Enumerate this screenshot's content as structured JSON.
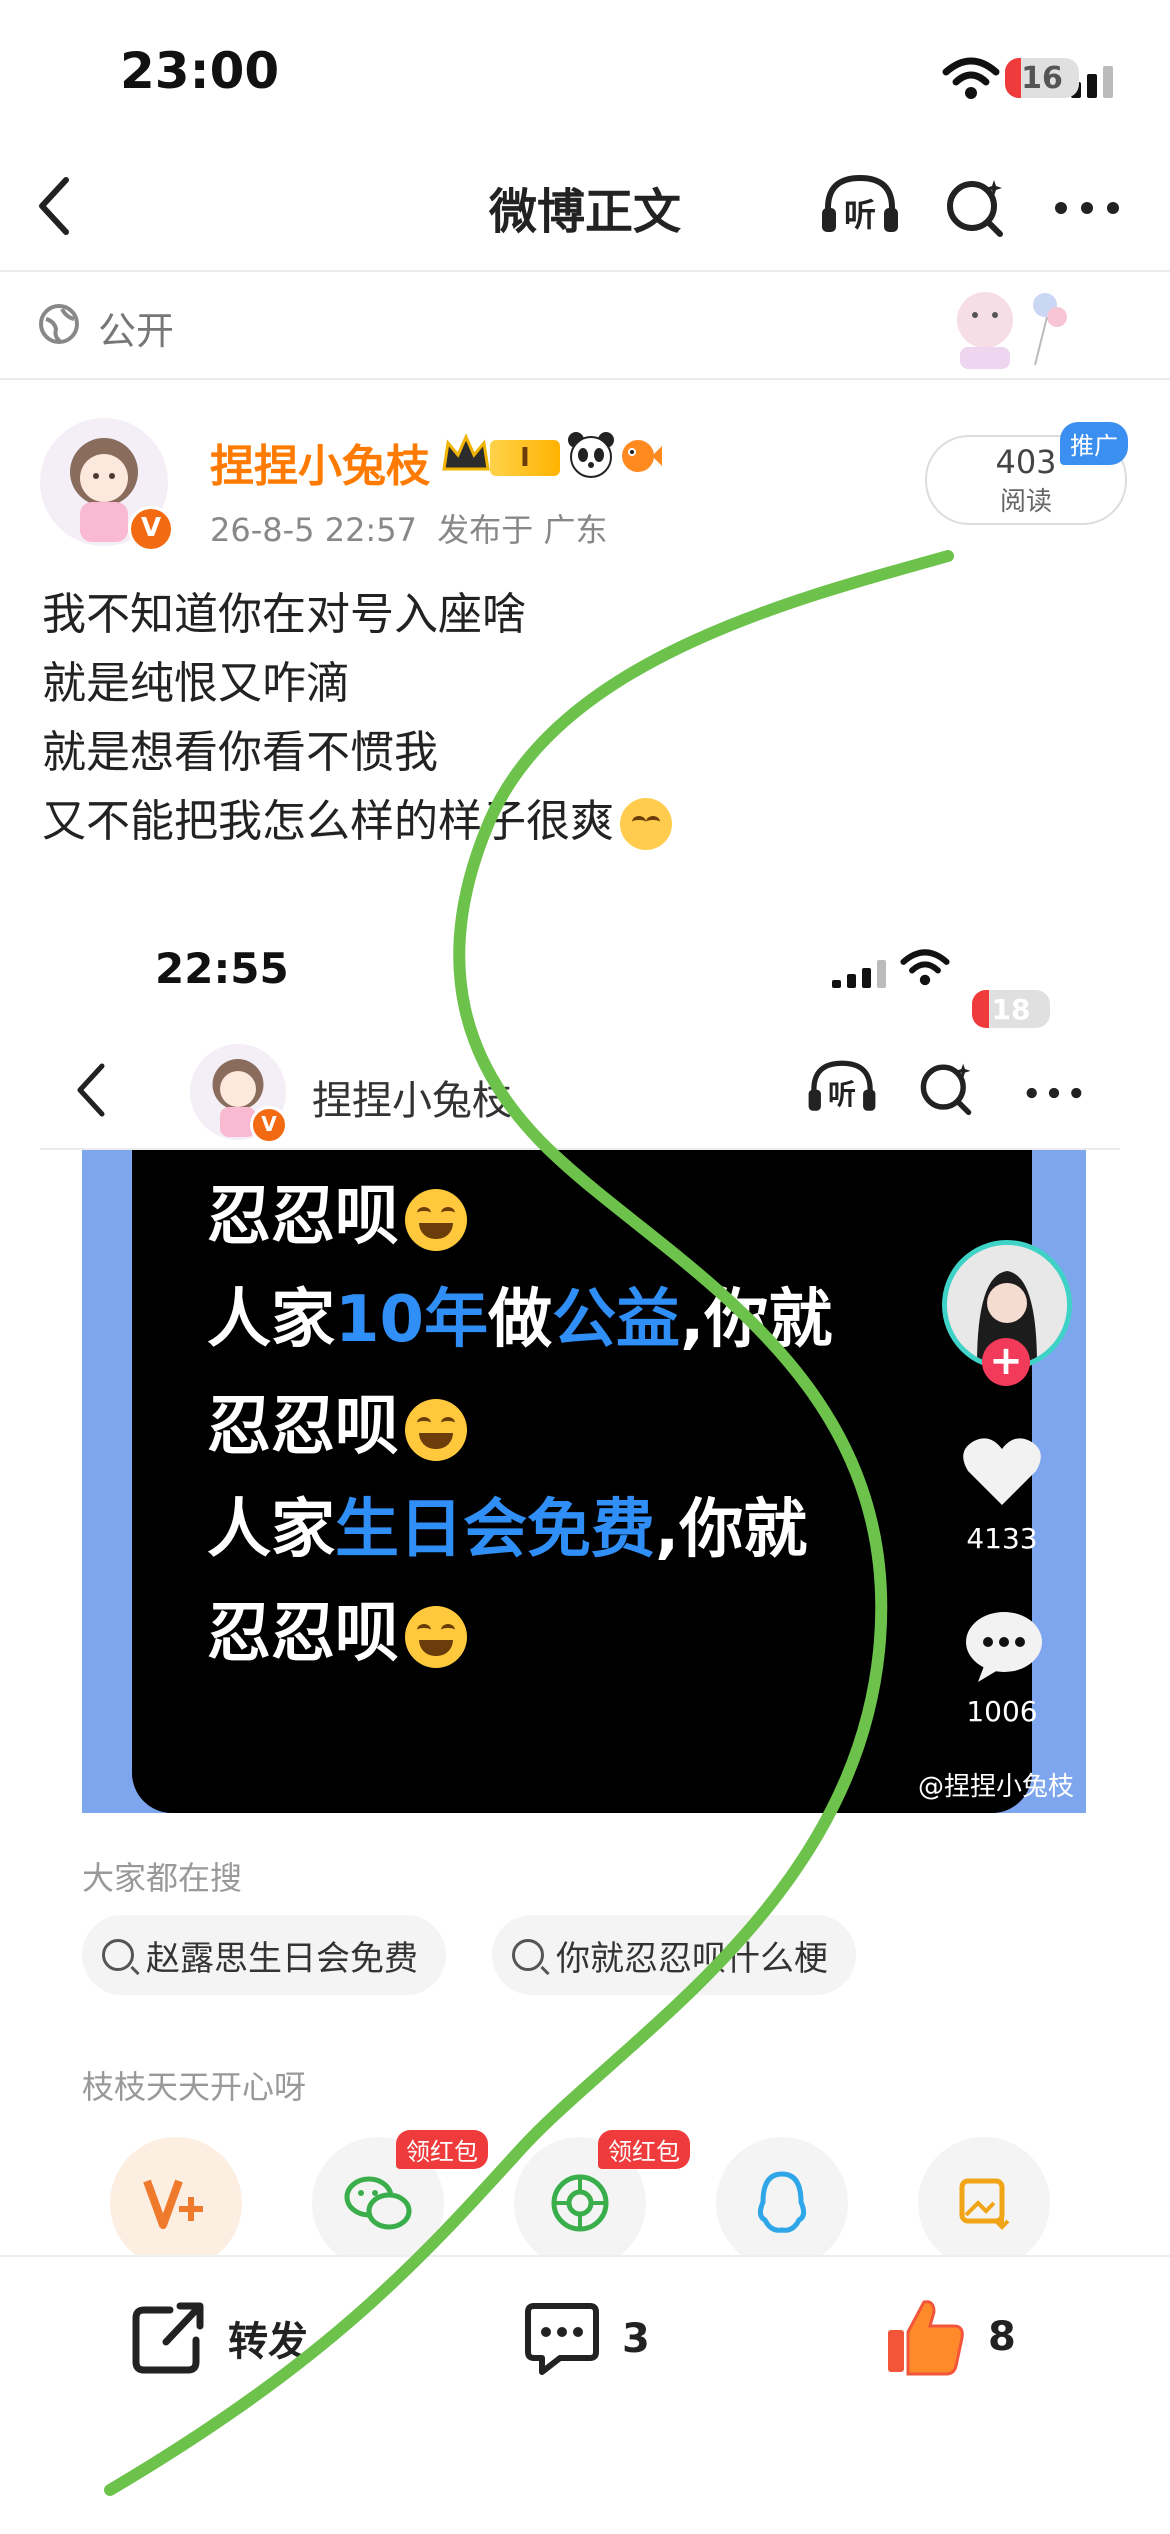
{
  "status_bar": {
    "time": "23:00",
    "battery": "16"
  },
  "nav": {
    "title": "微博正文",
    "listen_label": "听"
  },
  "visibility": {
    "label": "公开"
  },
  "author": {
    "name": "捏捏小兔枝",
    "level_badge": "I",
    "timestamp": "26-8-5 22:57",
    "published_in": "发布于 广东"
  },
  "reads": {
    "count": "403",
    "label": "阅读",
    "promo": "推广"
  },
  "post": {
    "lines": [
      "我不知道你在对号入座啥",
      "就是纯恨又咋滴",
      "就是想看你看不惯我",
      "又不能把我怎么样的样子很爽"
    ]
  },
  "embedded_screenshot": {
    "time": "22:55",
    "battery": "18",
    "author_name": "捏捏小兔枝",
    "listen_label": "听",
    "video": {
      "line1": "忍忍呗",
      "line2_a": "人家",
      "line2_b": "10年",
      "line2_c": "做",
      "line2_d": "公益",
      "line2_e": ",你就",
      "line3": "忍忍呗",
      "line4_a": "人家",
      "line4_b": "生日会免费",
      "line4_c": ",你就",
      "line5": "忍忍呗",
      "likes": "4133",
      "comments": "1006",
      "watermark": "@捏捏小兔枝"
    },
    "search": {
      "label": "大家都在搜",
      "chips": [
        "赵露思生日会免费",
        "你就忍忍呗什么梗"
      ]
    },
    "group_label": "枝枝天天开心呀",
    "share_tags": [
      "领红包",
      "领红包"
    ]
  },
  "actions": {
    "repost_label": "转发",
    "comment_count": "3",
    "like_count": "8"
  },
  "colors": {
    "accent": "#ff7a00",
    "annotation_stroke": "#6cc24a",
    "link_blue": "#2f8ff7"
  }
}
